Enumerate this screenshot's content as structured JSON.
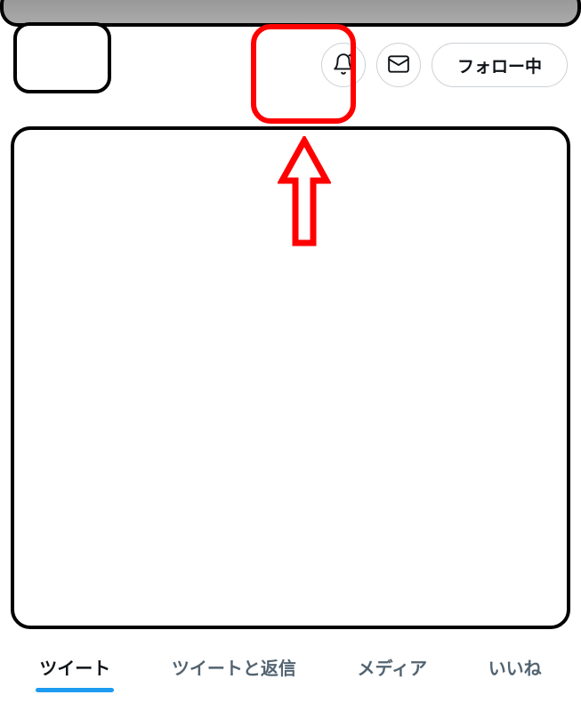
{
  "actions": {
    "notify_icon": "bell-plus",
    "message_icon": "envelope",
    "follow_label": "フォロー中"
  },
  "tabs": [
    {
      "label": "ツイート",
      "active": true
    },
    {
      "label": "ツイートと返信",
      "active": false
    },
    {
      "label": "メディア",
      "active": false
    },
    {
      "label": "いいね",
      "active": false
    }
  ],
  "annotations": {
    "highlight_target": "message-button",
    "arrow_color": "#ff0000"
  }
}
